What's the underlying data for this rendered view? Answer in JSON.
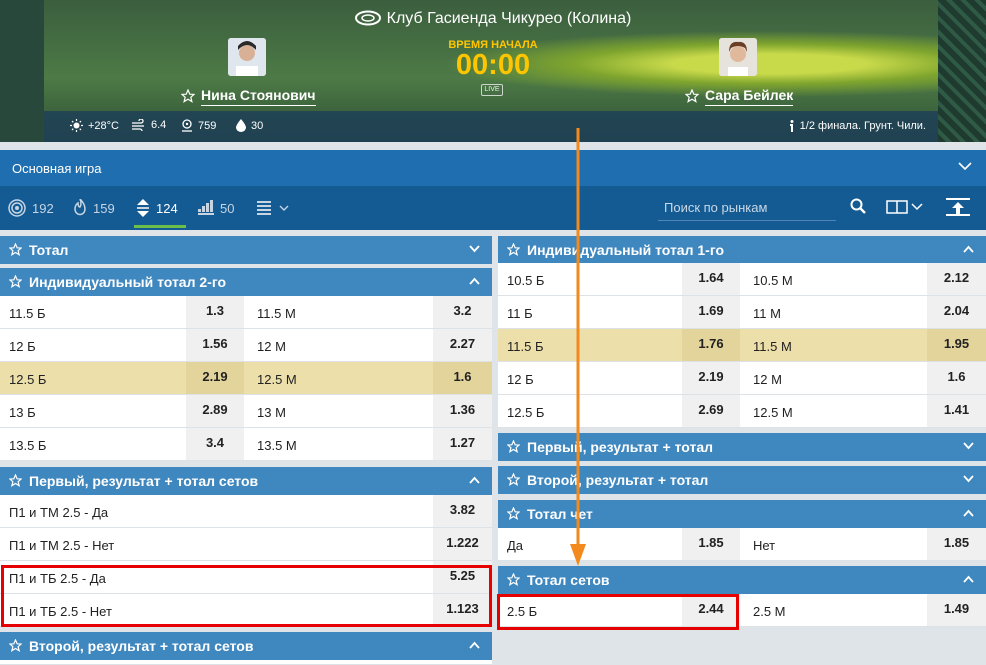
{
  "header": {
    "venue": "Клуб Гасиенда Чикуреo (Колина)",
    "timer_label": "ВРЕМЯ НАЧАЛА",
    "timer": "00:00",
    "live": "LIVE",
    "player1": "Нина Стоянович",
    "player2": "Сара Бейлек",
    "stats": {
      "temperature": "+28°C",
      "wind": "6.4",
      "pressure": "759",
      "humidity": "30"
    },
    "round_info": "1/2 финала. Грунт. Чили."
  },
  "main_game": {
    "label": "Основная игра"
  },
  "filters": [
    {
      "icon": "target-icon",
      "count": "192"
    },
    {
      "icon": "fire-icon",
      "count": "159"
    },
    {
      "icon": "updown-icon",
      "count": "124",
      "active": true
    },
    {
      "icon": "bars-icon",
      "count": "50"
    }
  ],
  "search": {
    "placeholder": "Поиск по рынкам"
  },
  "left": {
    "total": {
      "title": "Тотал"
    },
    "ind_total_2": {
      "title": "Индивидуальный тотал 2-го",
      "rows": [
        {
          "a": "11.5 Б",
          "ao": "1.3",
          "b": "11.5 М",
          "bo": "3.2"
        },
        {
          "a": "12 Б",
          "ao": "1.56",
          "b": "12 М",
          "bo": "2.27"
        },
        {
          "a": "12.5 Б",
          "ao": "2.19",
          "b": "12.5 М",
          "bo": "1.6"
        },
        {
          "a": "13 Б",
          "ao": "2.89",
          "b": "13 М",
          "bo": "1.36"
        },
        {
          "a": "13.5 Б",
          "ao": "3.4",
          "b": "13.5 М",
          "bo": "1.27"
        }
      ]
    },
    "first_sets": {
      "title": "Первый, результат + тотал сетов",
      "rows": [
        {
          "a": "П1 и ТМ 2.5 - Да",
          "ao": "3.82"
        },
        {
          "a": "П1 и ТМ 2.5 - Нет",
          "ao": "1.222"
        },
        {
          "a": "П1 и ТБ 2.5 - Да",
          "ao": "5.25"
        },
        {
          "a": "П1 и ТБ 2.5 - Нет",
          "ao": "1.123"
        }
      ]
    },
    "second_sets": {
      "title": "Второй, результат + тотал сетов"
    }
  },
  "right": {
    "ind_total_1": {
      "title": "Индивидуальный тотал 1-го",
      "rows": [
        {
          "a": "10.5 Б",
          "ao": "1.64",
          "b": "10.5 М",
          "bo": "2.12"
        },
        {
          "a": "11 Б",
          "ao": "1.69",
          "b": "11 М",
          "bo": "2.04"
        },
        {
          "a": "11.5 Б",
          "ao": "1.76",
          "b": "11.5 М",
          "bo": "1.95"
        },
        {
          "a": "12 Б",
          "ao": "2.19",
          "b": "12 М",
          "bo": "1.6"
        },
        {
          "a": "12.5 Б",
          "ao": "2.69",
          "b": "12.5 М",
          "bo": "1.41"
        }
      ]
    },
    "first_total": {
      "title": "Первый, результат + тотал"
    },
    "second_total": {
      "title": "Второй, результат + тотал"
    },
    "even_total": {
      "title": "Тотал чет",
      "row": {
        "a": "Да",
        "ao": "1.85",
        "b": "Нет",
        "bo": "1.85"
      }
    },
    "total_sets": {
      "title": "Тотал сетов",
      "row": {
        "a": "2.5 Б",
        "ao": "2.44",
        "b": "2.5 М",
        "bo": "1.49"
      }
    }
  },
  "colors": {
    "accent": "#3f87bf",
    "highlight": "#ecdfaa",
    "annotation_box": "#e60000",
    "annotation_arrow": "#f28a1d",
    "timer": "#ffc600"
  }
}
